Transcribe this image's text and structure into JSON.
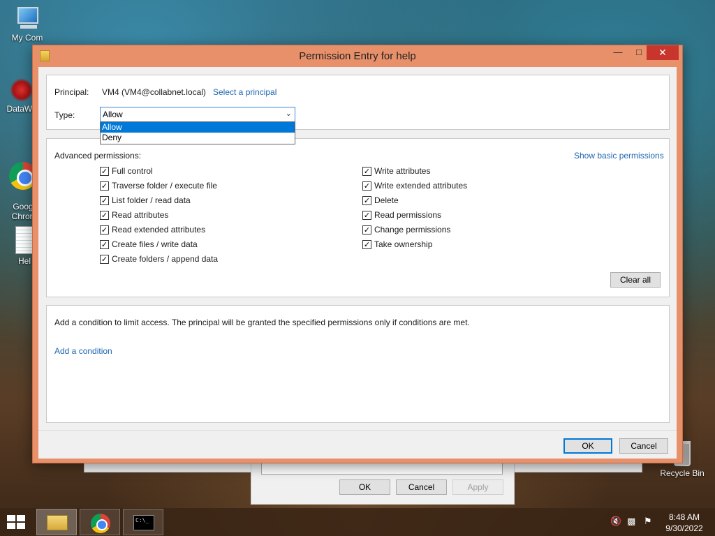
{
  "desktop": {
    "icons": [
      {
        "label": "My Com",
        "icon": "computer-icon"
      },
      {
        "label": "DataWa",
        "icon": "datawave-icon"
      },
      {
        "label": "Goog\nChron",
        "icon": "chrome-icon"
      },
      {
        "label": "Hel",
        "icon": "notepad-icon"
      },
      {
        "label": "Recycle Bin",
        "icon": "recycle-bin-icon"
      }
    ]
  },
  "background_dialog": {
    "ok_label": "OK",
    "cancel_label": "Cancel",
    "apply_label": "Apply"
  },
  "dialog": {
    "title": "Permission Entry for help",
    "principal_label": "Principal:",
    "principal_value": "VM4 (VM4@collabnet.local)",
    "select_principal_link": "Select a principal",
    "type_label": "Type:",
    "type_selected": "Allow",
    "type_options": [
      "Allow",
      "Deny"
    ],
    "advanced_label": "Advanced permissions:",
    "show_basic_link": "Show basic permissions",
    "permissions_left": [
      {
        "label": "Full control",
        "checked": true
      },
      {
        "label": "Traverse folder / execute file",
        "checked": true
      },
      {
        "label": "List folder / read data",
        "checked": true
      },
      {
        "label": "Read attributes",
        "checked": true
      },
      {
        "label": "Read extended attributes",
        "checked": true
      },
      {
        "label": "Create files / write data",
        "checked": true
      },
      {
        "label": "Create folders / append data",
        "checked": true
      }
    ],
    "permissions_right": [
      {
        "label": "Write attributes",
        "checked": true
      },
      {
        "label": "Write extended attributes",
        "checked": true
      },
      {
        "label": "Delete",
        "checked": true
      },
      {
        "label": "Read permissions",
        "checked": true
      },
      {
        "label": "Change permissions",
        "checked": true
      },
      {
        "label": "Take ownership",
        "checked": true
      }
    ],
    "clear_all_label": "Clear all",
    "condition_text": "Add a condition to limit access. The principal will be granted the specified permissions only if conditions are met.",
    "add_condition_link": "Add a condition",
    "ok_label": "OK",
    "cancel_label": "Cancel"
  },
  "taskbar": {
    "time": "8:48 AM",
    "date": "9/30/2022"
  }
}
